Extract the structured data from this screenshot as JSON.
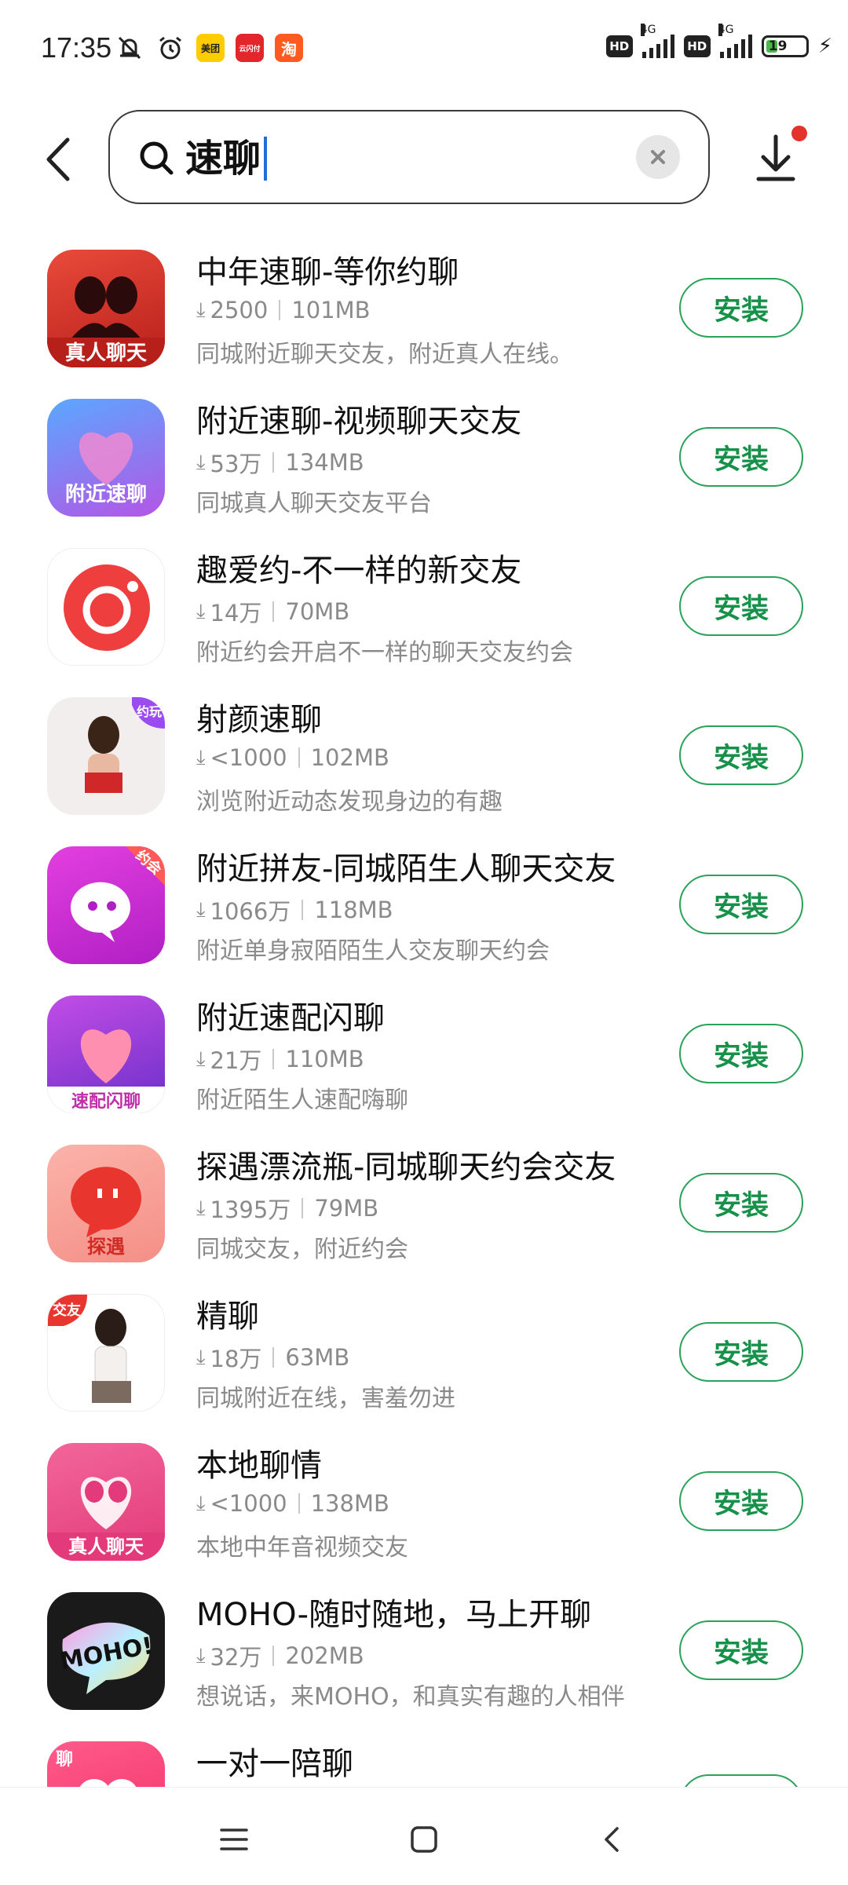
{
  "status_bar": {
    "time": "17:35",
    "battery": "19",
    "network1": "4G",
    "network2": "4G",
    "hd1": "HD",
    "hd2": "HD",
    "app_badges": [
      {
        "label": "美团",
        "color": "#ffcc00"
      },
      {
        "label": "云闪付",
        "color": "#e3262c"
      },
      {
        "label": "淘",
        "color": "#ff5a1f"
      }
    ]
  },
  "search": {
    "query": "速聊",
    "back_icon": "back-arrow-icon",
    "clear_icon": "clear-icon",
    "download_icon": "download-icon"
  },
  "install_label": "安装",
  "apps": [
    {
      "title": "中年速聊-等你约聊",
      "downloads": "2500",
      "size": "101MB",
      "desc": "同城附近聊天交友，附近真人在线。",
      "icon_text": "真人聊天",
      "icon_bg": "#d9342a"
    },
    {
      "title": "附近速聊-视频聊天交友",
      "downloads": "53万",
      "size": "134MB",
      "desc": "同城真人聊天交友平台",
      "icon_text": "附近速聊",
      "icon_bg": "#6a6cf0"
    },
    {
      "title": "趣爱约-不一样的新交友",
      "downloads": "14万",
      "size": "70MB",
      "desc": "附近约会开启不一样的聊天交友约会",
      "icon_text": "",
      "icon_bg": "#ffffff"
    },
    {
      "title": "射颜速聊",
      "downloads": "<1000",
      "size": "102MB",
      "desc": "浏览附近动态发现身边的有趣",
      "icon_text": "约玩",
      "icon_bg": "#f2eeee"
    },
    {
      "title": "附近拼友-同城陌生人聊天交友",
      "downloads": "1066万",
      "size": "118MB",
      "desc": "附近单身寂陌陌生人交友聊天约会",
      "icon_text": "约会",
      "icon_bg": "#d729d6"
    },
    {
      "title": "附近速配闪聊",
      "downloads": "21万",
      "size": "110MB",
      "desc": "附近陌生人速配嗨聊",
      "icon_text": "速配闪聊",
      "icon_bg": "#a33bd8"
    },
    {
      "title": "探遇漂流瓶-同城聊天约会交友",
      "downloads": "1395万",
      "size": "79MB",
      "desc": "同城交友，附近约会",
      "icon_text": "探遇",
      "icon_bg": "#f7a6a0"
    },
    {
      "title": "精聊",
      "downloads": "18万",
      "size": "63MB",
      "desc": "同城附近在线，害羞勿进",
      "icon_text": "交友",
      "icon_bg": "#ffffff"
    },
    {
      "title": "本地聊情",
      "downloads": "<1000",
      "size": "138MB",
      "desc": "本地中年音视频交友",
      "icon_text": "真人聊天",
      "icon_bg": "#ea4f8a"
    },
    {
      "title": "MOHO-随时随地，马上开聊",
      "downloads": "32万",
      "size": "202MB",
      "desc": "想说话，来MOHO，和真实有趣的人相伴",
      "icon_text": "MOHO!",
      "icon_bg": "#1a1a1a"
    },
    {
      "title": "一对一陪聊",
      "downloads": "",
      "size": "",
      "desc": "",
      "icon_text": "聊",
      "icon_bg": "#f0427a"
    }
  ]
}
